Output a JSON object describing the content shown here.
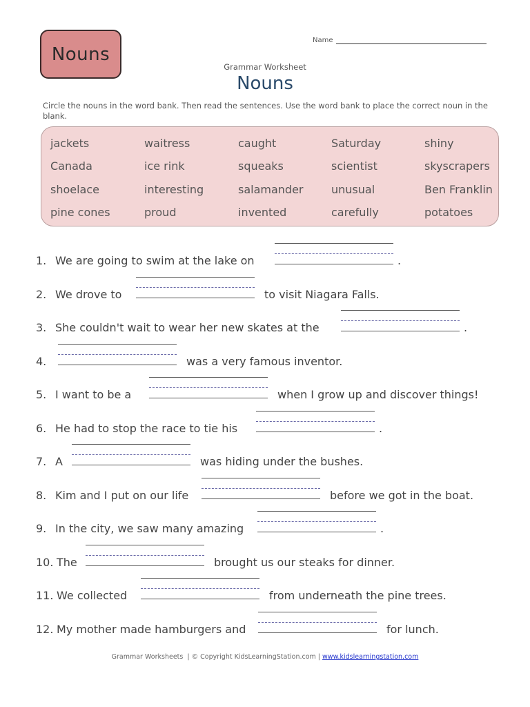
{
  "badge": {
    "label": "Nouns"
  },
  "name_field": {
    "label": "Name"
  },
  "header": {
    "subtitle": "Grammar Worksheet",
    "title": "Nouns"
  },
  "instructions": "Circle the nouns in the word bank.  Then read the sentences.  Use the word bank to place the correct noun in the blank.",
  "word_bank": {
    "rows": [
      [
        "jackets",
        "waitress",
        "caught",
        "Saturday",
        "shiny"
      ],
      [
        "Canada",
        "ice rink",
        "squeaks",
        "scientist",
        "skyscrapers"
      ],
      [
        "shoelace",
        "interesting",
        "salamander",
        "unusual",
        "Ben Franklin"
      ],
      [
        "pine cones",
        "proud",
        "invented",
        "carefully",
        "potatoes"
      ]
    ]
  },
  "questions": [
    {
      "number": "1.",
      "before": "We are going to swim at the lake on",
      "after": "."
    },
    {
      "number": "2.",
      "before": "We drove to",
      "after": "to visit Niagara Falls."
    },
    {
      "number": "3.",
      "before": "She couldn't wait to wear her new skates at the",
      "after": "."
    },
    {
      "number": "4.",
      "before": "",
      "after": "was a very famous inventor."
    },
    {
      "number": "5.",
      "before": "I want to be a",
      "after": "when I grow up and discover things!"
    },
    {
      "number": "6.",
      "before": "He had to stop the race to tie his",
      "after": "."
    },
    {
      "number": "7.",
      "before": "A",
      "after": "was hiding under the bushes."
    },
    {
      "number": "8.",
      "before": "Kim and I put on our life",
      "after": "before we got in the boat."
    },
    {
      "number": "9.",
      "before": "In the city, we saw many amazing",
      "after": "."
    },
    {
      "number": "10.",
      "before": "The",
      "after": "brought us our steaks for dinner."
    },
    {
      "number": "11.",
      "before": "We collected",
      "after": "from underneath the pine trees."
    },
    {
      "number": "12.",
      "before": "My mother made hamburgers and",
      "after": "for lunch."
    }
  ],
  "footer": {
    "left": "Grammar Worksheets",
    "copyright": "| © Copyright KidsLearningStation.com |",
    "link": "www.kidslearningstation.com"
  }
}
